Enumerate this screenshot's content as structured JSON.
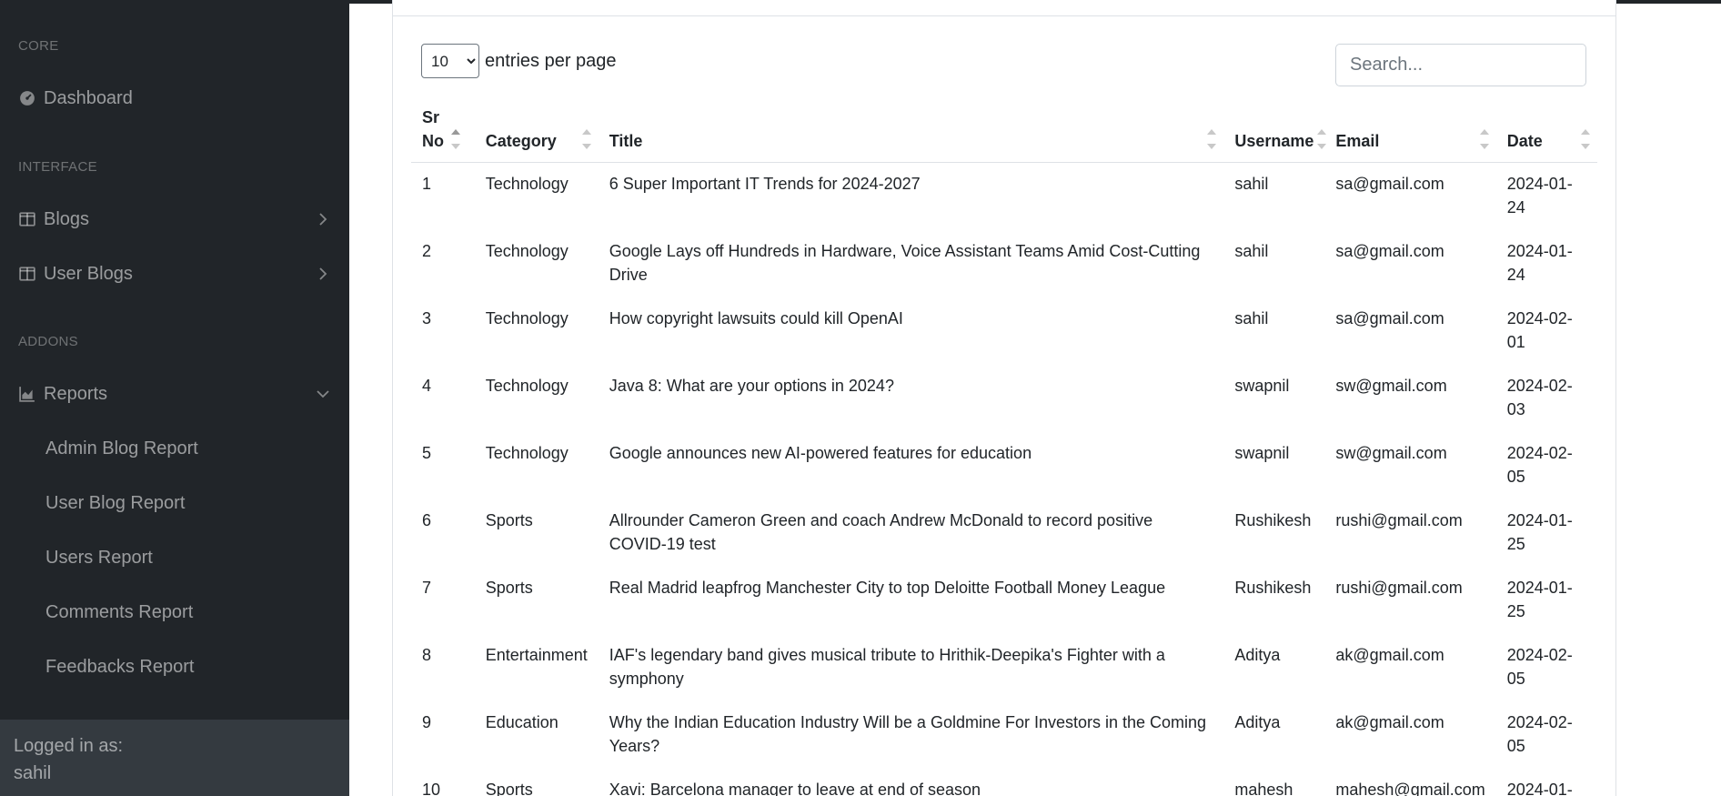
{
  "sidebar": {
    "sections": {
      "core": "CORE",
      "interface": "INTERFACE",
      "addons": "ADDONS"
    },
    "items": {
      "dashboard": "Dashboard",
      "blogs": "Blogs",
      "user_blogs": "User Blogs",
      "reports": "Reports"
    },
    "reports_sub": {
      "admin_blog_report": "Admin Blog Report",
      "user_blog_report": "User Blog Report",
      "users_report": "Users Report",
      "comments_report": "Comments Report",
      "feedbacks_report": "Feedbacks Report"
    },
    "footer": {
      "label": "Logged in as:",
      "user": "sahil"
    }
  },
  "datatable": {
    "per_page_value": "10",
    "per_page_label": "entries per page",
    "search_placeholder": "Search...",
    "columns": {
      "sr_no": "Sr No",
      "category": "Category",
      "title": "Title",
      "username": "Username",
      "email": "Email",
      "date": "Date"
    },
    "rows": [
      {
        "sr": "1",
        "category": "Technology",
        "title": "6 Super Important IT Trends for 2024-2027",
        "username": "sahil",
        "email": "sa@gmail.com",
        "date": "2024-01-24"
      },
      {
        "sr": "2",
        "category": "Technology",
        "title": "Google Lays off Hundreds in Hardware, Voice Assistant Teams Amid Cost-Cutting Drive",
        "username": "sahil",
        "email": "sa@gmail.com",
        "date": "2024-01-24"
      },
      {
        "sr": "3",
        "category": "Technology",
        "title": "How copyright lawsuits could kill OpenAI",
        "username": "sahil",
        "email": "sa@gmail.com",
        "date": "2024-02-01"
      },
      {
        "sr": "4",
        "category": "Technology",
        "title": "Java 8: What are your options in 2024?",
        "username": "swapnil",
        "email": "sw@gmail.com",
        "date": "2024-02-03"
      },
      {
        "sr": "5",
        "category": "Technology",
        "title": "Google announces new AI-powered features for education",
        "username": "swapnil",
        "email": "sw@gmail.com",
        "date": "2024-02-05"
      },
      {
        "sr": "6",
        "category": "Sports",
        "title": "Allrounder Cameron Green and coach Andrew McDonald to record positive COVID-19 test",
        "username": "Rushikesh",
        "email": "rushi@gmail.com",
        "date": "2024-01-25"
      },
      {
        "sr": "7",
        "category": "Sports",
        "title": "Real Madrid leapfrog Manchester City to top Deloitte Football Money League",
        "username": "Rushikesh",
        "email": "rushi@gmail.com",
        "date": "2024-01-25"
      },
      {
        "sr": "8",
        "category": "Entertainment",
        "title": "IAF's legendary band gives musical tribute to Hrithik-Deepika's Fighter with a symphony",
        "username": "Aditya",
        "email": "ak@gmail.com",
        "date": "2024-02-05"
      },
      {
        "sr": "9",
        "category": "Education",
        "title": "Why the Indian Education Industry Will be a Goldmine For Investors in the Coming Years?",
        "username": "Aditya",
        "email": "ak@gmail.com",
        "date": "2024-02-05"
      },
      {
        "sr": "10",
        "category": "Sports",
        "title": "Xavi: Barcelona manager to leave at end of season",
        "username": "mahesh",
        "email": "mahesh@gmail.com",
        "date": "2024-01-"
      }
    ]
  }
}
